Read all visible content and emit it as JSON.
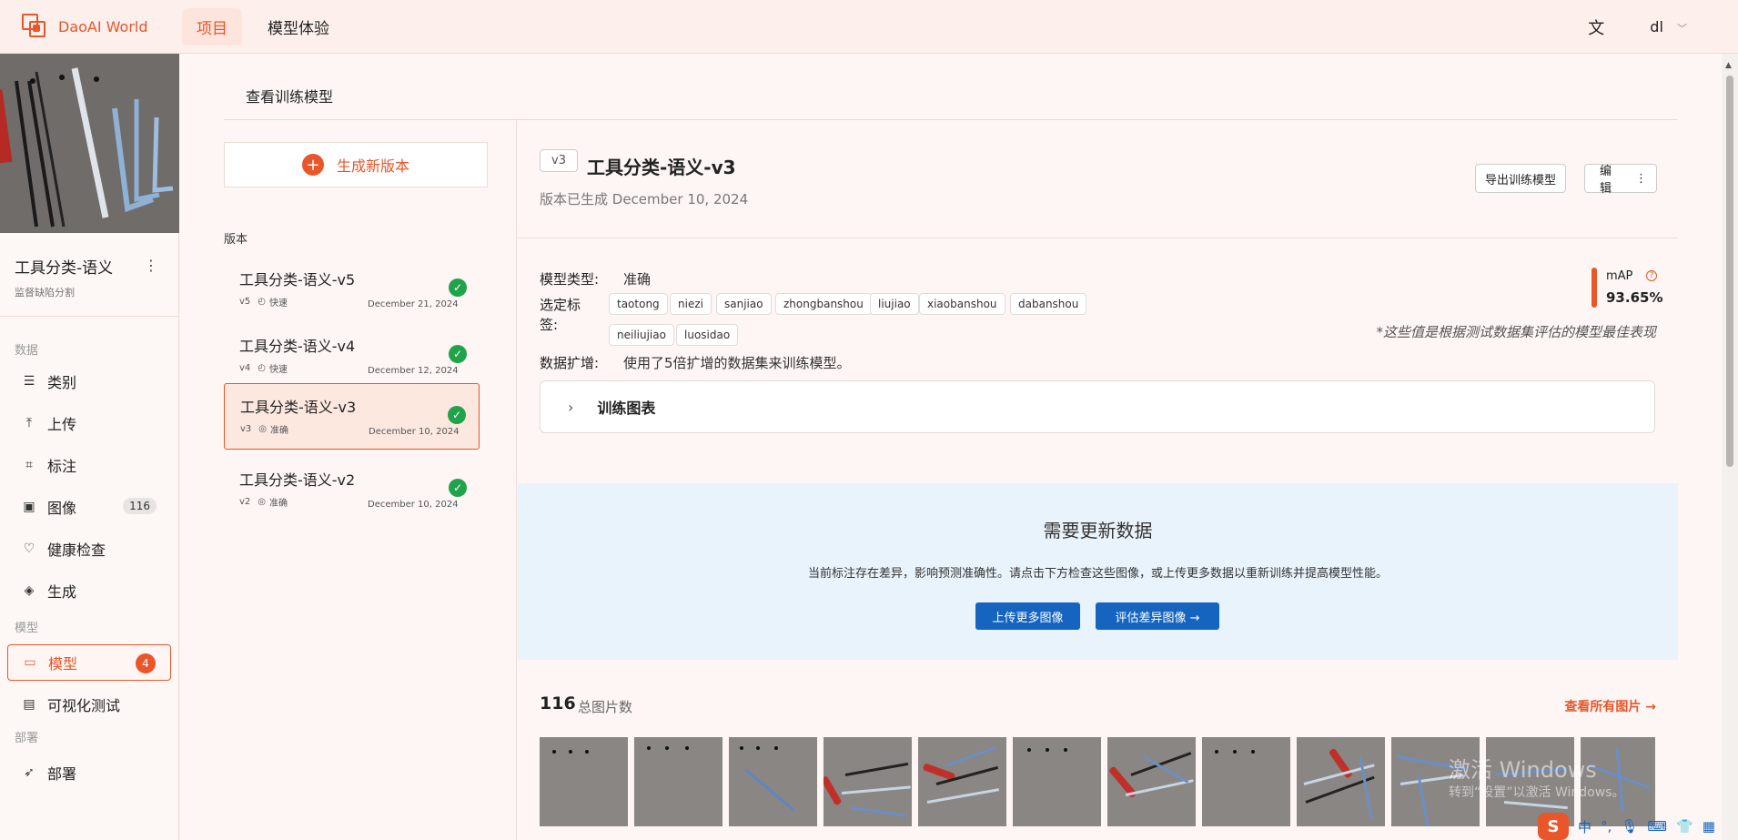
{
  "app": {
    "name": "DaoAI World"
  },
  "nav": {
    "tabs": [
      {
        "label": "项目"
      },
      {
        "label": "模型体验"
      }
    ]
  },
  "user": {
    "name": "dl"
  },
  "project": {
    "name": "工具分类-语义",
    "type": "监督缺陷分割"
  },
  "sidebar": {
    "groups": {
      "data": "数据",
      "model": "模型",
      "deploy": "部署"
    },
    "items": [
      {
        "label": "类别",
        "icon": "list-icon"
      },
      {
        "label": "上传",
        "icon": "upload-icon"
      },
      {
        "label": "标注",
        "icon": "annotate-icon"
      },
      {
        "label": "图像",
        "icon": "image-icon",
        "badge": "116"
      },
      {
        "label": "健康检查",
        "icon": "heart-pulse-icon"
      },
      {
        "label": "生成",
        "icon": "layers-icon"
      },
      {
        "label": "模型",
        "icon": "folder-icon",
        "badge": "4"
      },
      {
        "label": "可视化测试",
        "icon": "document-icon"
      },
      {
        "label": "部署",
        "icon": "rocket-icon"
      }
    ]
  },
  "page": {
    "title": "查看训练模型"
  },
  "versions": {
    "new_button": "生成新版本",
    "label": "版本",
    "list": [
      {
        "name": "工具分类-语义-v5",
        "tag": "v5",
        "mode": "快速",
        "date": "December 21, 2024"
      },
      {
        "name": "工具分类-语义-v4",
        "tag": "v4",
        "mode": "快速",
        "date": "December 12, 2024"
      },
      {
        "name": "工具分类-语义-v3",
        "tag": "v3",
        "mode": "准确",
        "date": "December 10, 2024"
      },
      {
        "name": "工具分类-语义-v2",
        "tag": "v2",
        "mode": "准确",
        "date": "December 10, 2024"
      }
    ]
  },
  "detail": {
    "version_badge": "v3",
    "title": "工具分类-语义-v3",
    "subtitle": "版本已生成 December 10, 2024",
    "export_button": "导出训练模型",
    "edit_button": "编 辑",
    "model_type_label": "模型类型:",
    "model_type_value": "准确",
    "tags_label_1": "选定标",
    "tags_label_2": "签:",
    "tags": [
      "taotong",
      "niezi",
      "sanjiao",
      "zhongbanshou",
      "liujiao",
      "xiaobanshou",
      "dabanshou",
      "neiliujiao",
      "luosidao"
    ],
    "augment_label": "数据扩增:",
    "augment_value": "使用了5倍扩增的数据集来训练模型。",
    "map_label": "mAP",
    "map_value": "93.65%",
    "map_note": "*这些值是根据测试数据集评估的模型最佳表现",
    "accordion": "训练图表"
  },
  "update": {
    "title": "需要更新数据",
    "desc": "当前标注存在差异，影响预测准确性。请点击下方检查这些图像，或上传更多数据以重新训练并提高模型性能。",
    "upload_button": "上传更多图像",
    "evaluate_button": "评估差异图像 →"
  },
  "images": {
    "count": "116",
    "count_label": "总图片数",
    "view_all": "查看所有图片 →"
  },
  "watermark": {
    "line1": "激活 Windows",
    "line2": "转到“设置”以激活 Windows。"
  },
  "tray": {
    "ime": "中"
  },
  "colors": {
    "accent": "#e8562a",
    "primary": "#1565c0",
    "success": "#21a34b"
  }
}
